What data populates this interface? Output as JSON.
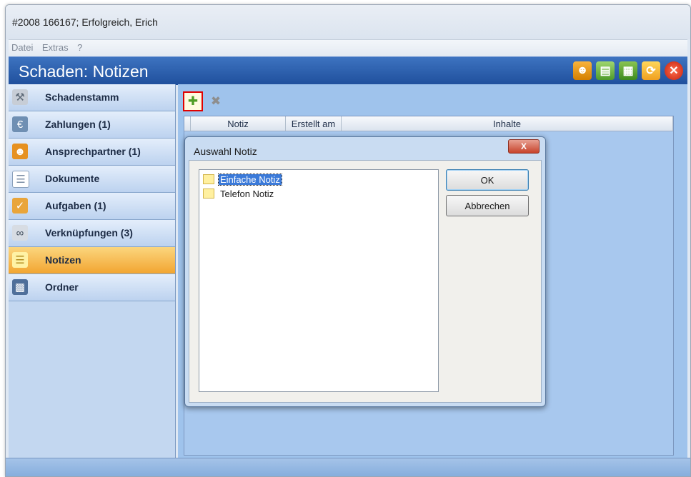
{
  "window": {
    "title": "#2008 166167; Erfolgreich, Erich"
  },
  "menu": {
    "items": [
      "Datei",
      "Extras",
      "?"
    ]
  },
  "header": {
    "title": "Schaden: Notizen",
    "icons": [
      "contact-icon",
      "export-icon",
      "save-icon",
      "refresh-icon",
      "close-icon"
    ]
  },
  "sidebar": {
    "items": [
      {
        "label": "Schadenstamm",
        "icon": "wrench-icon",
        "active": false
      },
      {
        "label": "Zahlungen (1)",
        "icon": "payment-icon",
        "active": false
      },
      {
        "label": "Ansprechpartner (1)",
        "icon": "person-icon",
        "active": false
      },
      {
        "label": "Dokumente",
        "icon": "document-icon",
        "active": false
      },
      {
        "label": "Aufgaben (1)",
        "icon": "task-icon",
        "active": false
      },
      {
        "label": "Verknüpfungen (3)",
        "icon": "link-icon",
        "active": false
      },
      {
        "label": "Notizen",
        "icon": "note-icon",
        "active": true
      },
      {
        "label": "Ordner",
        "icon": "folder-icon",
        "active": false
      }
    ]
  },
  "toolbar": {
    "add_icon": "add-note-icon",
    "delete_icon": "delete-icon"
  },
  "grid": {
    "columns": [
      "Notiz",
      "Erstellt am",
      "Inhalte"
    ]
  },
  "dialog": {
    "title": "Auswahl Notiz",
    "close_label": "X",
    "options": [
      {
        "label": "Einfache Notiz",
        "selected": true
      },
      {
        "label": "Telefon Notiz",
        "selected": false
      }
    ],
    "ok_label": "OK",
    "cancel_label": "Abbrechen"
  }
}
